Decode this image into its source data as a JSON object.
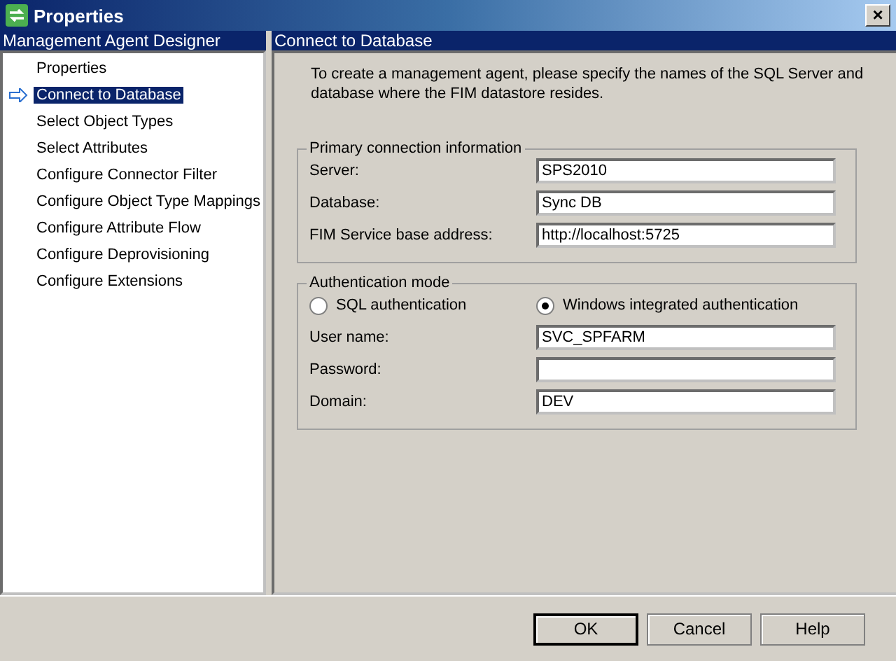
{
  "window": {
    "title": "Properties",
    "close": "×"
  },
  "sidebar": {
    "header": "Management Agent Designer",
    "items": [
      {
        "label": "Properties",
        "selected": false
      },
      {
        "label": "Connect to Database",
        "selected": true
      },
      {
        "label": "Select Object Types",
        "selected": false
      },
      {
        "label": "Select Attributes",
        "selected": false
      },
      {
        "label": "Configure Connector Filter",
        "selected": false
      },
      {
        "label": "Configure Object Type Mappings",
        "selected": false
      },
      {
        "label": "Configure Attribute Flow",
        "selected": false
      },
      {
        "label": "Configure Deprovisioning",
        "selected": false
      },
      {
        "label": "Configure Extensions",
        "selected": false
      }
    ]
  },
  "content": {
    "header": "Connect to Database",
    "intro": "To create a management agent, please specify the names of the SQL Server and database where the FIM datastore resides.",
    "primary": {
      "legend": "Primary connection information",
      "fields": [
        {
          "label": "Server:",
          "value": "SPS2010"
        },
        {
          "label": "Database:",
          "value": "Sync DB"
        },
        {
          "label": "FIM Service base address:",
          "value": "http://localhost:5725"
        }
      ]
    },
    "auth": {
      "legend": "Authentication mode",
      "options": [
        {
          "label": "SQL authentication",
          "selected": false
        },
        {
          "label": "Windows integrated authentication",
          "selected": true
        }
      ],
      "fields": [
        {
          "label": "User name:",
          "value": "SVC_SPFARM"
        },
        {
          "label": "Password:"
        },
        {
          "label": "Domain:",
          "value": "DEV"
        }
      ]
    }
  },
  "buttons": [
    {
      "label": "OK",
      "default": true
    },
    {
      "label": "Cancel",
      "default": false
    },
    {
      "label": "Help",
      "default": false
    }
  ]
}
